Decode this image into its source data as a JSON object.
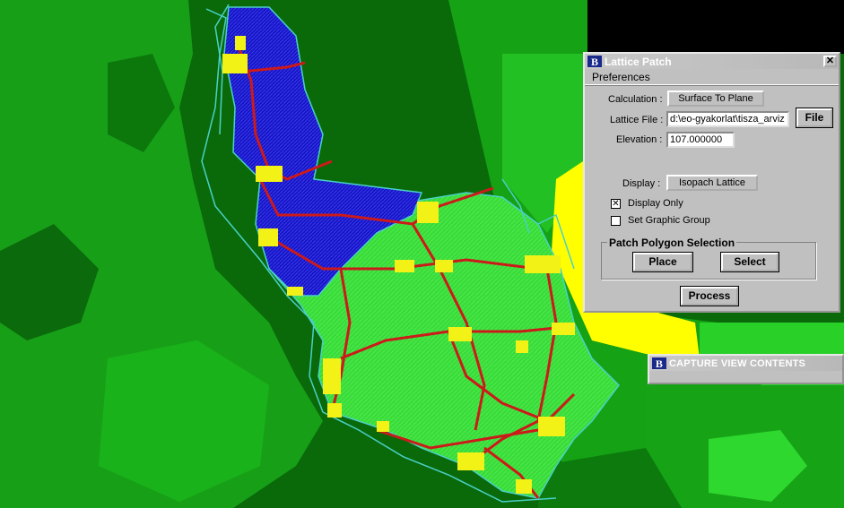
{
  "lattice_dialog": {
    "title": "Lattice Patch",
    "close_glyph": "✕",
    "menu": {
      "preferences": "Preferences"
    },
    "calculation": {
      "label": "Calculation :",
      "value": "Surface To Plane"
    },
    "lattice_file": {
      "label": "Lattice File :",
      "value": "d:\\eo-gyakorlat\\tisza_arviz",
      "button": "File"
    },
    "elevation": {
      "label": "Elevation :",
      "value": "107.000000"
    },
    "display": {
      "label": "Display :",
      "value": "Isopach Lattice"
    },
    "display_only": {
      "label": "Display Only",
      "checked": true,
      "mark": "✕"
    },
    "set_graphic_group": {
      "label": "Set Graphic Group",
      "checked": false
    },
    "patch_polygon": {
      "title": "Patch Polygon Selection",
      "place": "Place",
      "select": "Select"
    },
    "process": "Process"
  },
  "capture_dialog": {
    "title": "CAPTURE VIEW CONTENTS"
  },
  "icons": {
    "app_icon": "bentley-b-icon"
  },
  "colors": {
    "dark_green": "#0a6a0a",
    "mid_green": "#16a416",
    "light_green": "#2ed82e",
    "flood_blue": "#1212cc",
    "road_red": "#cc1a1a",
    "settlement_yellow": "#f2f216",
    "raster_yellow": "#ffff00",
    "river_cyan": "#4ad0c8",
    "black": "#000000"
  }
}
